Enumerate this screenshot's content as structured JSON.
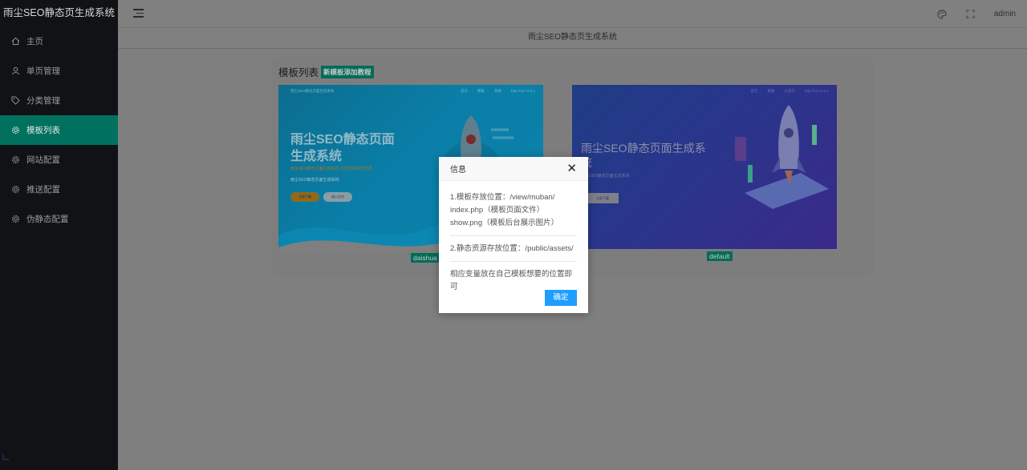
{
  "sidebar": {
    "brand": "雨尘SEO静态页生成系统",
    "items": [
      {
        "label": "主页",
        "icon": "home-icon"
      },
      {
        "label": "单页管理",
        "icon": "user-icon"
      },
      {
        "label": "分类管理",
        "icon": "tag-icon"
      },
      {
        "label": "模板列表",
        "icon": "gear-icon",
        "active": true
      },
      {
        "label": "网站配置",
        "icon": "gear-icon"
      },
      {
        "label": "推送配置",
        "icon": "gear-icon"
      },
      {
        "label": "伪静态配置",
        "icon": "gear-icon"
      }
    ]
  },
  "header": {
    "user": "admin",
    "page_title": "雨尘SEO静态页生成系统"
  },
  "main": {
    "title": "模板列表",
    "tag": "新模板添加教程",
    "templates": [
      {
        "name": "daishua",
        "nav_brand": "雨尘SEO静态页面生成系统",
        "nav_links": [
          "首页",
          "模板",
          "系统",
          "http://127.0.0.1"
        ],
        "headline_1": "雨尘SEO静态页面",
        "headline_2": "生成系统",
        "sub_1": "雨尘SEO静态页面生成系统 让您的网站更优秀",
        "sub_2": "雨尘SEO静态页面生成系统",
        "btn_1": "立即下载",
        "btn_2": "进入后台"
      },
      {
        "name": "default",
        "nav_links": [
          "首页",
          "模板",
          "分类页",
          "http://127.0.0.1"
        ],
        "headline_1": "雨尘SEO静态页面生成系",
        "headline_2": "统",
        "sub": "雨尘SEO静态页面生成系统",
        "btn": "立即下载"
      }
    ]
  },
  "modal": {
    "title": "信息",
    "line1": "1.模板存放位置：/view/muban/",
    "line2": "index.php（模板页面文件）",
    "line3": "show.png（模板后台展示图片）",
    "line4": "2.静态资源存放位置：/public/assets/",
    "line5": "相应变量放在自己模板想要的位置即可",
    "ok": "确定"
  },
  "colors": {
    "sidebar_bg": "#101216",
    "active_bg": "#00705f",
    "accent": "#1e9fff",
    "tag_bg": "#006c57"
  }
}
